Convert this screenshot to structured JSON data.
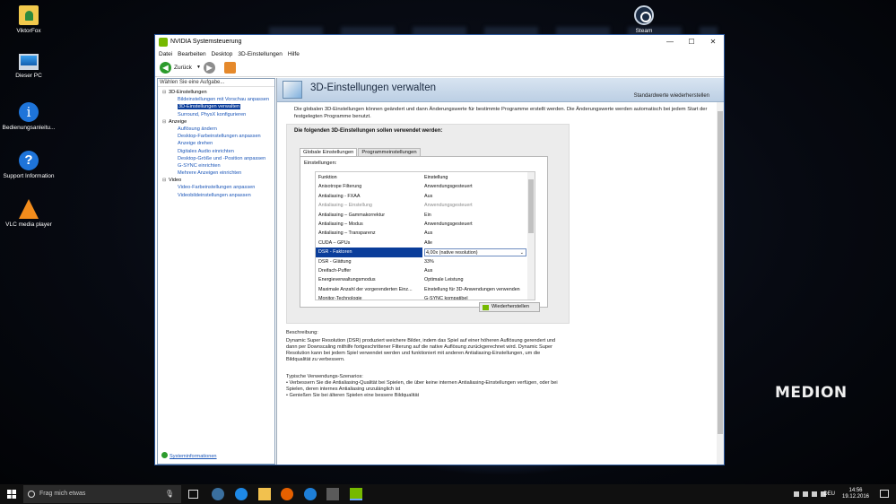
{
  "desktop": {
    "icons": [
      "ViktorFox",
      "Dieser PC",
      "Bedienungsanleitu...",
      "Support Information",
      "VLC media player",
      "Steam"
    ],
    "brand": "MEDION"
  },
  "window": {
    "title": "NVIDIA Systemsteuerung",
    "controls": {
      "minimize": "—",
      "maximize": "☐",
      "close": "✕"
    },
    "menu": [
      "Datei",
      "Bearbeiten",
      "Desktop",
      "3D-Einstellungen",
      "Hilfe"
    ],
    "toolbar": {
      "back_label": "Zurück",
      "dropdown": "▼",
      "back_glyph": "◀",
      "forward_glyph": "▶"
    }
  },
  "left_panel": {
    "header": "Wählen Sie eine Aufgabe...",
    "tree": [
      {
        "type": "cat",
        "toggle": "⊟",
        "label": "3D-Einstellungen"
      },
      {
        "type": "item",
        "label": "Bildeinstellungen mit Vorschau anpassen"
      },
      {
        "type": "item",
        "label": "3D-Einstellungen verwalten",
        "selected": true
      },
      {
        "type": "item",
        "label": "Surround, PhysX konfigurieren"
      },
      {
        "type": "cat",
        "toggle": "⊟",
        "label": "Anzeige"
      },
      {
        "type": "item",
        "label": "Auflösung ändern"
      },
      {
        "type": "item",
        "label": "Desktop-Farbeinstellungen anpassen"
      },
      {
        "type": "item",
        "label": "Anzeige drehen"
      },
      {
        "type": "item",
        "label": "Digitales Audio einrichten"
      },
      {
        "type": "item",
        "label": "Desktop-Größe und -Position anpassen"
      },
      {
        "type": "item",
        "label": "G-SYNC einrichten"
      },
      {
        "type": "item",
        "label": "Mehrere Anzeigen einrichten"
      },
      {
        "type": "cat",
        "toggle": "⊟",
        "label": "Video"
      },
      {
        "type": "item",
        "label": "Video-Farbeinstellungen anpassen"
      },
      {
        "type": "item",
        "label": "Videobildeinstellungen anpassen"
      }
    ],
    "sysinfo": "Systeminformationen"
  },
  "right_panel": {
    "title": "3D-Einstellungen verwalten",
    "restore_defaults": "Standardwerte wiederherstellen",
    "intro": "Die globalen 3D-Einstellungen können geändert und dann Änderungswerte für bestimmte Programme erstellt werden. Die Änderungswerte werden automatisch bei jedem Start der festgelegten Programme benutzt.",
    "section_title": "Die folgenden 3D-Einstellungen sollen verwendet werden:",
    "tabs": [
      "Globale Einstellungen",
      "Programmeinstellungen"
    ],
    "settings_label": "Einstellungen:",
    "columns": [
      "Funktion",
      "Einstellung"
    ],
    "rows": [
      {
        "f": "Anisotrope Filterung",
        "v": "Anwendungsgesteuert"
      },
      {
        "f": "Antialiasing - FXAA",
        "v": "Aus"
      },
      {
        "f": "Antialiasing – Einstellung",
        "v": "Anwendungsgesteuert",
        "disabled": true
      },
      {
        "f": "Antialiasing – Gammakorrektur",
        "v": "Ein"
      },
      {
        "f": "Antialiasing – Modus",
        "v": "Anwendungsgesteuert"
      },
      {
        "f": "Antialiasing – Transparenz",
        "v": "Aus"
      },
      {
        "f": "CUDA – GPUs",
        "v": "Alle"
      },
      {
        "f": "DSR - Faktoren",
        "v": "4,00x (native resolution)",
        "selected": true
      },
      {
        "f": "DSR - Glättung",
        "v": "33%"
      },
      {
        "f": "Dreifach-Puffer",
        "v": "Aus"
      },
      {
        "f": "Energieverwaltungsmodus",
        "v": "Optimale Leistung"
      },
      {
        "f": "Maximale Anzahl der vorgerenderten Einz...",
        "v": "Einstellung für 3D-Anwendungen verwenden"
      },
      {
        "f": "Monitor-Technologie",
        "v": "G-SYNC kompatibel"
      }
    ],
    "restore_button": "Wiederherstellen",
    "description_label": "Beschreibung:",
    "description": "Dynamic Super Resolution (DSR) produziert weichere Bilder, indem das Spiel auf einer höheren Auflösung gerendert und dann per Downscaling mithilfe fortgeschrittener Filterung auf die native Auflösung zurückgerechnet wird. Dynamic Super Resolution kann bei jedem Spiel verwendet werden und funktioniert mit anderen Antialiasing-Einstellungen, um die Bildqualität zu verbessern.",
    "usecase_label": "Typische Verwendungs-Szenarios:",
    "usecases": [
      "• Verbessern Sie die Antialiasing-Qualität bei Spielen, die über keine internen Antialiasing-Einstellungen verfügen, oder bei Spielen, deren internes Antialiasing unzulänglich ist",
      "• Genießen Sie bei älteren Spielen eine bessere Bildqualität"
    ]
  },
  "taskbar": {
    "search_placeholder": "Frag mich etwas",
    "lang": "DEU",
    "time": "14:56",
    "date": "19.12.2016"
  }
}
